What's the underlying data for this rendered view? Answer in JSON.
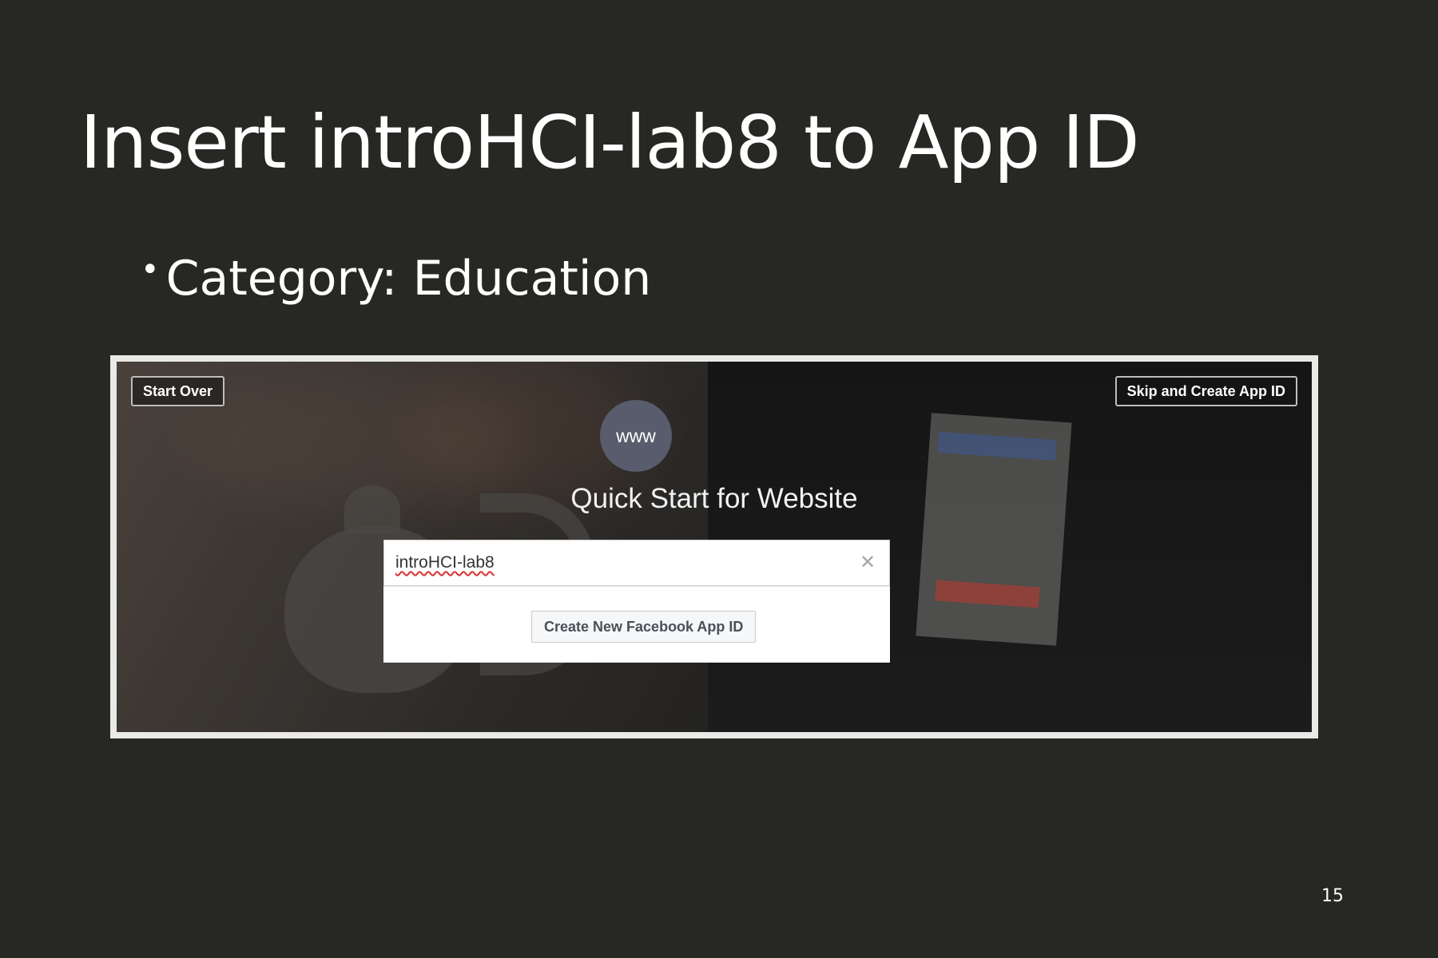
{
  "slide": {
    "title": "Insert introHCI-lab8 to App ID",
    "bullet_symbol": "•",
    "bullet": "Category: Education",
    "page_number": "15"
  },
  "screenshot": {
    "start_over_label": "Start Over",
    "skip_label": "Skip and Create App ID",
    "www_badge": "www",
    "heading": "Quick Start for Website",
    "input_value": "introHCI-lab8",
    "clear_icon": "close-icon",
    "create_button_label": "Create New Facebook App ID"
  },
  "colors": {
    "background": "#272723",
    "www_circle": "#585c6c",
    "facebook_blue": "#3b5998"
  }
}
